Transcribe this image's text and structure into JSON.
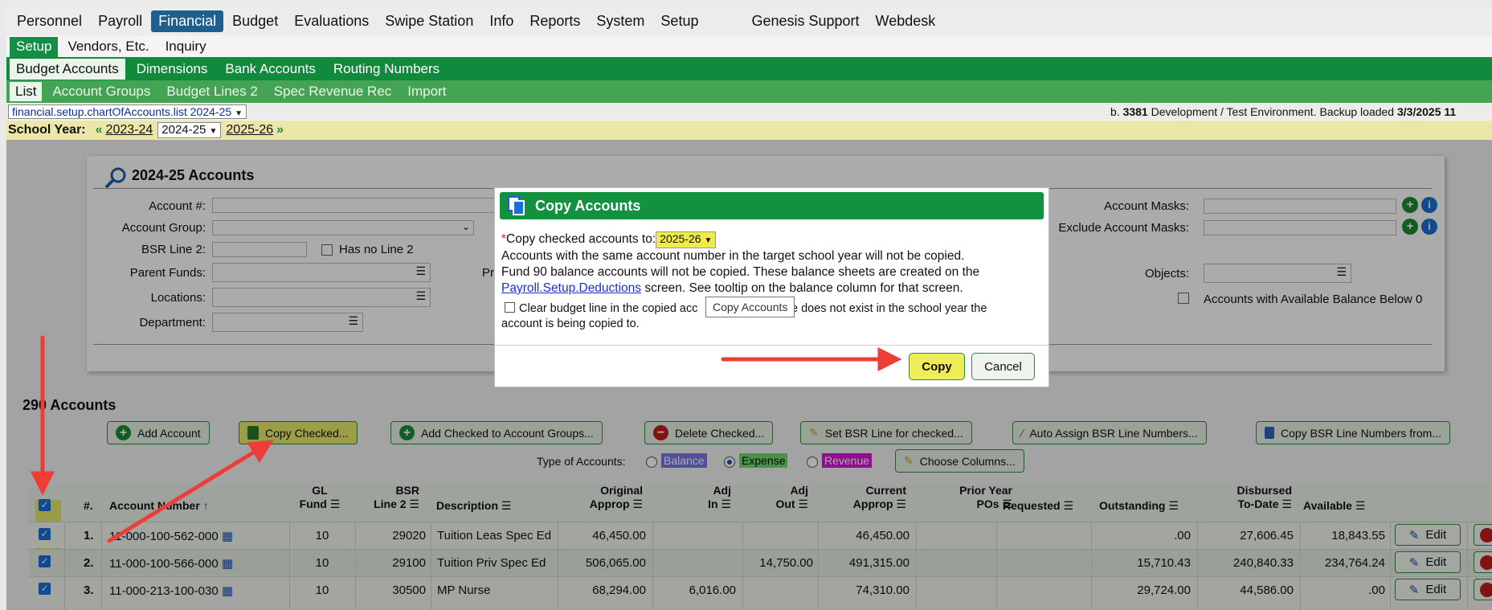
{
  "menu": [
    "Personnel",
    "Payroll",
    "Financial",
    "Budget",
    "Evaluations",
    "Swipe Station",
    "Info",
    "Reports",
    "System",
    "Setup"
  ],
  "menu_right": [
    "Genesis Support",
    "Webdesk"
  ],
  "sub_menu": [
    "Setup",
    "Vendors, Etc.",
    "Inquiry"
  ],
  "tabs_l2": [
    "Budget Accounts",
    "Dimensions",
    "Bank Accounts",
    "Routing Numbers"
  ],
  "tabs_l3": [
    "List",
    "Account Groups",
    "Budget Lines 2",
    "Spec Revenue Rec",
    "Import"
  ],
  "path_select": "financial.setup.chartOfAccounts.list 2024-25",
  "env": {
    "prefix": "b.",
    "build": "3381",
    "text": "Development / Test Environment. Backup loaded",
    "date": "3/3/2025 11"
  },
  "school_year": {
    "label": "School Year:",
    "prev": "2023-24",
    "current": "2024-25",
    "next": "2025-26"
  },
  "filter": {
    "title": "2024-25 Accounts",
    "account_num_label": "Account #:",
    "account_group_label": "Account Group:",
    "bsr_line2_label": "BSR Line 2:",
    "has_no_line2_label": "Has no Line 2",
    "parent_funds_label": "Parent Funds:",
    "pr_partial": "Pr",
    "locations_label": "Locations:",
    "department_label": "Department:",
    "account_masks_label": "Account Masks:",
    "exclude_masks_label": "Exclude Account Masks:",
    "objects_label": "Objects:",
    "avail_below_label": "Accounts with Available Balance Below 0"
  },
  "accounts": {
    "count_title": "290 Accounts",
    "buttons": {
      "add": "Add Account",
      "copy_checked": "Copy Checked...",
      "add_groups": "Add Checked to Account Groups...",
      "delete": "Delete Checked...",
      "set_bsr": "Set BSR Line for checked...",
      "auto_bsr": "Auto Assign BSR Line Numbers...",
      "copy_bsr": "Copy BSR Line Numbers from..."
    },
    "type_label": "Type of Accounts:",
    "types": [
      "Balance",
      "Expense",
      "Revenue"
    ],
    "choose_columns": "Choose Columns..."
  },
  "table": {
    "headers": {
      "num": "#.",
      "account_number": "Account Number",
      "gl_fund_1": "GL",
      "gl_fund_2": "Fund",
      "bsr_1": "BSR",
      "bsr_2": "Line 2",
      "description": "Description",
      "orig_1": "Original",
      "orig_2": "Approp",
      "adjin_1": "Adj",
      "adjin_2": "In",
      "adjout_1": "Adj",
      "adjout_2": "Out",
      "curr_1": "Current",
      "curr_2": "Approp",
      "prior_1": "Prior Year",
      "prior_2": "POs",
      "requested": "Requested",
      "outstanding": "Outstanding",
      "disb_1": "Disbursed",
      "disb_2": "To-Date",
      "available": "Available"
    },
    "rows": [
      {
        "num": "1.",
        "account": "11-000-100-562-000",
        "fund": "10",
        "bsr": "29020",
        "desc": "Tuition Leas Spec Ed",
        "orig": "46,450.00",
        "adj_in": "",
        "adj_out": "",
        "curr": "46,450.00",
        "prior": "",
        "requested": "",
        "outstanding": ".00",
        "disbursed": "27,606.45",
        "available": "18,843.55",
        "edit": "Edit"
      },
      {
        "num": "2.",
        "account": "11-000-100-566-000",
        "fund": "10",
        "bsr": "29100",
        "desc": "Tuition Priv Spec Ed",
        "orig": "506,065.00",
        "adj_in": "",
        "adj_out": "14,750.00",
        "curr": "491,315.00",
        "prior": "",
        "requested": "",
        "outstanding": "15,710.43",
        "disbursed": "240,840.33",
        "available": "234,764.24",
        "edit": "Edit"
      },
      {
        "num": "3.",
        "account": "11-000-213-100-030",
        "fund": "10",
        "bsr": "30500",
        "desc": "MP Nurse",
        "orig": "68,294.00",
        "adj_in": "6,016.00",
        "adj_out": "",
        "curr": "74,310.00",
        "prior": "",
        "requested": "",
        "outstanding": "29,724.00",
        "disbursed": "44,586.00",
        "available": ".00",
        "edit": "Edit"
      }
    ]
  },
  "dialog": {
    "title": "Copy Accounts",
    "req_mark": "*",
    "copy_to_label": "Copy checked accounts to:",
    "target_year": "2025-26",
    "line1": "Accounts with the same account number in the target school year will not be copied.",
    "line2": "Fund 90 balance accounts will not be copied. These balance sheets are created on the",
    "link": "Payroll.Setup.Deductions",
    "line3": "screen. See tooltip on the balance column for that screen.",
    "clear_a": "Clear budget line in the copied acc",
    "clear_b": "line does not exist in the school year the",
    "clear_c": "account is being copied to.",
    "tooltip": "Copy Accounts",
    "copy_btn": "Copy",
    "cancel_btn": "Cancel"
  }
}
